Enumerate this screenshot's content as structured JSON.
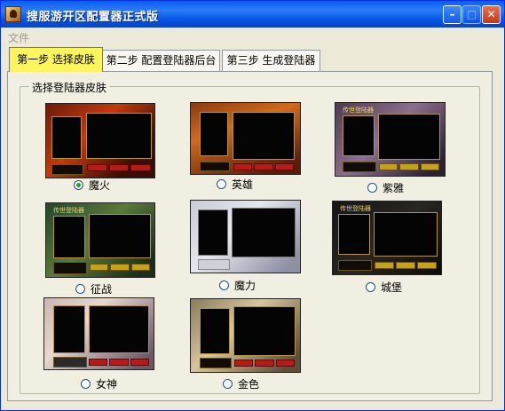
{
  "window": {
    "title": "搜服游开区配置器正式版"
  },
  "menubar": {
    "file": "文件"
  },
  "tabs": [
    {
      "label": "第一步 选择皮肤",
      "active": true
    },
    {
      "label": "第二步 配置登陆器后台",
      "active": false
    },
    {
      "label": "第三步 生成登陆器",
      "active": false
    }
  ],
  "group": {
    "title": "选择登陆器皮肤"
  },
  "skins": [
    {
      "label": "魔火",
      "selected": true,
      "header": ""
    },
    {
      "label": "英雄",
      "selected": false,
      "header": ""
    },
    {
      "label": "紫雅",
      "selected": false,
      "header": "传世登陆器"
    },
    {
      "label": "征战",
      "selected": false,
      "header": "传世登陆器"
    },
    {
      "label": "魔力",
      "selected": false,
      "header": ""
    },
    {
      "label": "城堡",
      "selected": false,
      "header": "传世登陆器"
    },
    {
      "label": "女神",
      "selected": false,
      "header": ""
    },
    {
      "label": "金色",
      "selected": false,
      "header": ""
    }
  ],
  "colors": {
    "titlebar": "#0a5ef0",
    "active_tab": "#fdf55e",
    "window_bg": "#ece9d8"
  }
}
